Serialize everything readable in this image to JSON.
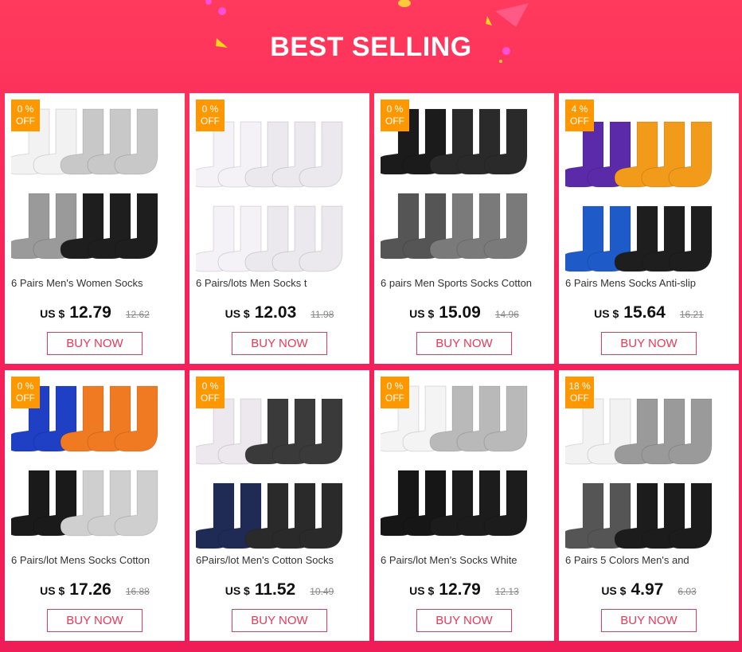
{
  "banner": {
    "title": "BEST SELLING"
  },
  "colors": {
    "accent": "#e8385a",
    "badge": "#ff9800",
    "background": "#f7205a"
  },
  "products": [
    {
      "discount_line1": "0 %",
      "discount_line2": "OFF",
      "title": "6 Pairs Men's Women Socks",
      "currency": "US $",
      "price": "12.79",
      "old_price": "12.62",
      "button": "BUY NOW",
      "image": "white-gray-black-crew-socks",
      "colors": [
        "#f2f2f2",
        "#c8c8c8",
        "#9a9a9a",
        "#1e1e1e"
      ]
    },
    {
      "discount_line1": "0 %",
      "discount_line2": "OFF",
      "title": "6 Pairs/lots Men Socks        t",
      "currency": "US $",
      "price": "12.03",
      "old_price": "11.98",
      "button": "BUY NOW",
      "image": "white-ankle-socks",
      "colors": [
        "#f4f2f6",
        "#ebe8ee",
        "#f4f2f6",
        "#ebe8ee"
      ]
    },
    {
      "discount_line1": "0 %",
      "discount_line2": "OFF",
      "title": "6 pairs Men Sports Socks Cotton",
      "currency": "US $",
      "price": "15.09",
      "old_price": "14.96",
      "button": "BUY NOW",
      "image": "black-gray-sport-socks",
      "colors": [
        "#1b1b1b",
        "#2a2a2a",
        "#555555",
        "#7a7a7a"
      ]
    },
    {
      "discount_line1": "4 %",
      "discount_line2": "OFF",
      "title": "6 Pairs Mens Socks Anti-slip",
      "currency": "US $",
      "price": "15.64",
      "old_price": "16.21",
      "button": "BUY NOW",
      "image": "colorful-running-socks",
      "colors": [
        "#5a2aa8",
        "#f29a1a",
        "#1e5bc8",
        "#1e1e1e"
      ]
    },
    {
      "discount_line1": "0 %",
      "discount_line2": "OFF",
      "title": "6 Pairs/lot Mens Socks Cotton",
      "currency": "US $",
      "price": "17.26",
      "old_price": "16.88",
      "button": "BUY NOW",
      "image": "blue-orange-black-athletic-socks",
      "colors": [
        "#1f3fc4",
        "#f07a22",
        "#1a1a1a",
        "#cfcfcf"
      ]
    },
    {
      "discount_line1": "0 %",
      "discount_line2": "OFF",
      "title": "6Pairs/lot Men's Cotton Socks",
      "currency": "US $",
      "price": "11.52",
      "old_price": "10.49",
      "button": "BUY NOW",
      "image": "white-navy-gray-crew-socks",
      "colors": [
        "#ece8ee",
        "#3a3a3a",
        "#1f2a55",
        "#2a2a2a"
      ]
    },
    {
      "discount_line1": "0 %",
      "discount_line2": "OFF",
      "title": "6 Pairs/lot Men's Socks White",
      "currency": "US $",
      "price": "12.79",
      "old_price": "12.13",
      "button": "BUY NOW",
      "image": "white-gray-black-socks",
      "colors": [
        "#f4f4f4",
        "#b9b9b9",
        "#161616",
        "#1c1c1c"
      ]
    },
    {
      "discount_line1": "18 %",
      "discount_line2": "OFF",
      "title": "6 Pairs 5 Colors Men's and",
      "currency": "US $",
      "price": "4.97",
      "old_price": "6.03",
      "button": "BUY NOW",
      "image": "low-cut-mixed-socks",
      "colors": [
        "#f2f2f2",
        "#9a9a9a",
        "#555555",
        "#1c1c1c"
      ]
    }
  ]
}
